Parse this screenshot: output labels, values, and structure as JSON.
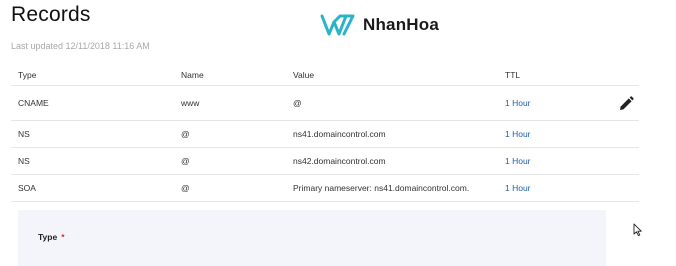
{
  "page": {
    "title": "Records",
    "last_updated": "Last updated 12/11/2018 11:16 AM",
    "logo_text": "NhanHoa"
  },
  "columns": {
    "type": "Type",
    "name": "Name",
    "value": "Value",
    "ttl": "TTL"
  },
  "records": [
    {
      "type": "CNAME",
      "name": "www",
      "value": "@",
      "ttl": "1 Hour"
    },
    {
      "type": "NS",
      "name": "@",
      "value": "ns41.domaincontrol.com",
      "ttl": "1 Hour"
    },
    {
      "type": "NS",
      "name": "@",
      "value": "ns42.domaincontrol.com",
      "ttl": "1 Hour"
    },
    {
      "type": "SOA",
      "name": "@",
      "value": "Primary nameserver: ns41.domaincontrol.com.",
      "ttl": "1 Hour"
    }
  ],
  "form": {
    "type_label": "Type",
    "required_mark": "*"
  },
  "icons": {
    "logo": "nhanhoa-logo-icon",
    "edit": "pencil-icon",
    "cursor": "mouse-pointer-icon"
  },
  "colors": {
    "ttl_link": "#1f5fa8",
    "required": "#d62f2f",
    "logo_teal": "#2bb3c8",
    "panel_bg": "#f4f5fa"
  }
}
